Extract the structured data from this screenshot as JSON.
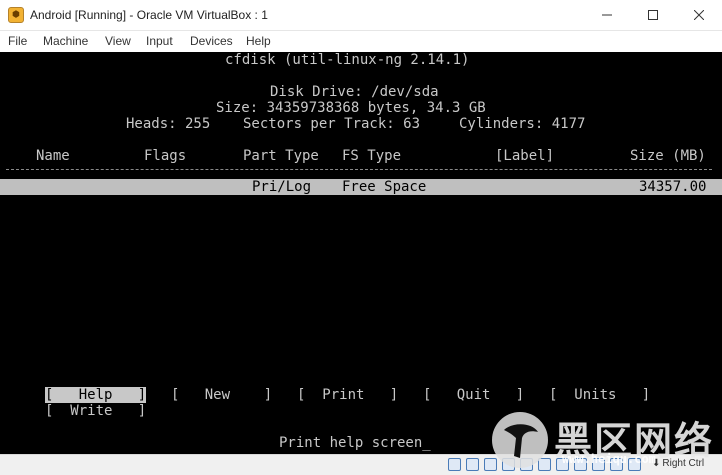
{
  "window": {
    "title": "Android [Running] - Oracle VM VirtualBox : 1",
    "icon": "virtualbox-icon"
  },
  "menu": [
    "File",
    "Machine",
    "View",
    "Input",
    "Devices",
    "Help"
  ],
  "terminal": {
    "program": "cfdisk (util-linux-ng 2.14.1)",
    "disk_drive": "Disk Drive: /dev/sda",
    "size": "Size: 34359738368 bytes, 34.3 GB",
    "geometry": {
      "heads": "Heads: 255",
      "sectors": "Sectors per Track: 63",
      "cylinders": "Cylinders: 4177"
    },
    "columns": {
      "name": "Name",
      "flags": "Flags",
      "part_type": "Part Type",
      "fs_type": "FS Type",
      "label": "[Label]",
      "size": "Size (MB)"
    },
    "partition_row": {
      "part_type": "Pri/Log",
      "fs_type": "Free Space",
      "size": "34357.00"
    },
    "buttons": [
      "[   Help   ]",
      "[   New    ]",
      "[  Print   ]",
      "[   Quit   ]",
      "[  Units   ]",
      "[  Write   ]"
    ],
    "status_line": "Print help screen_"
  },
  "statusbar": {
    "host_key": "Right Ctrl"
  },
  "watermark": {
    "text": "黑区网络",
    "url": "www.heiqu.com"
  },
  "colors": {
    "terminal_bg": "#000000",
    "terminal_fg": "#c8c8c8",
    "highlight_bg": "#bfbfbf",
    "accent": "#4a7bb7"
  }
}
